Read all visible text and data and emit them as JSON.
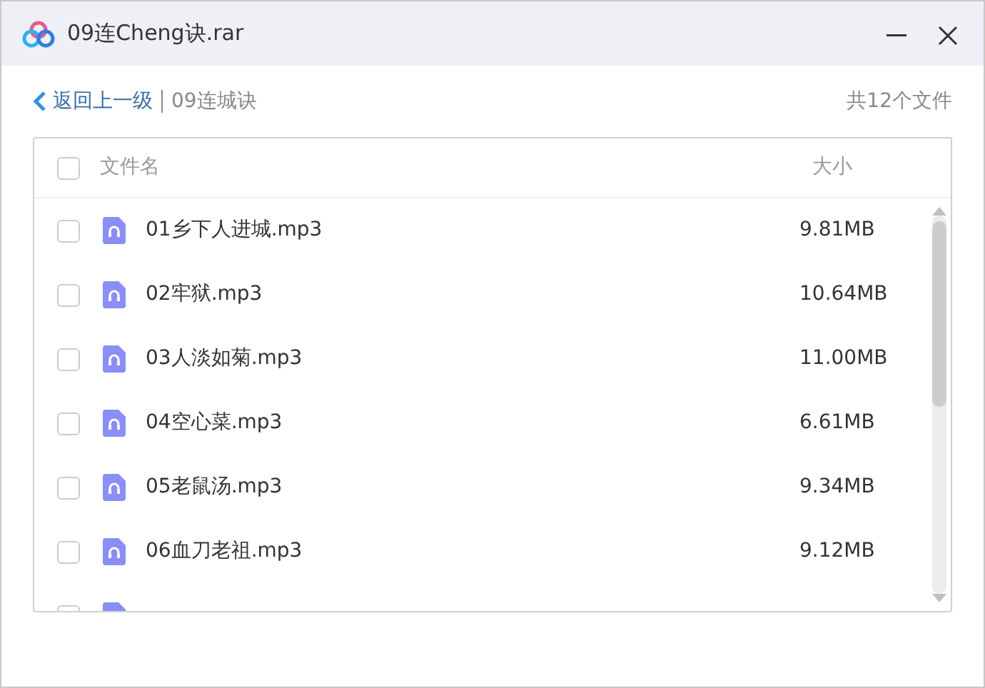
{
  "window": {
    "title": "09连Cheng诀.rar"
  },
  "nav": {
    "back": "返回上一级",
    "path": "09连城诀",
    "count": "共12个文件"
  },
  "table": {
    "columns": [
      "文件名",
      "大小"
    ],
    "all_checked": false,
    "rows": [
      {
        "name": "01乡下人进城.mp3",
        "size": "9.81MB",
        "checked": false
      },
      {
        "name": "02牢狱.mp3",
        "size": "10.64MB",
        "checked": false
      },
      {
        "name": "03人淡如菊.mp3",
        "size": "11.00MB",
        "checked": false
      },
      {
        "name": "04空心菜.mp3",
        "size": "6.61MB",
        "checked": false
      },
      {
        "name": "05老鼠汤.mp3",
        "size": "9.34MB",
        "checked": false
      },
      {
        "name": "06血刀老祖.mp3",
        "size": "9.12MB",
        "checked": false
      },
      {
        "checked": false
      }
    ]
  }
}
